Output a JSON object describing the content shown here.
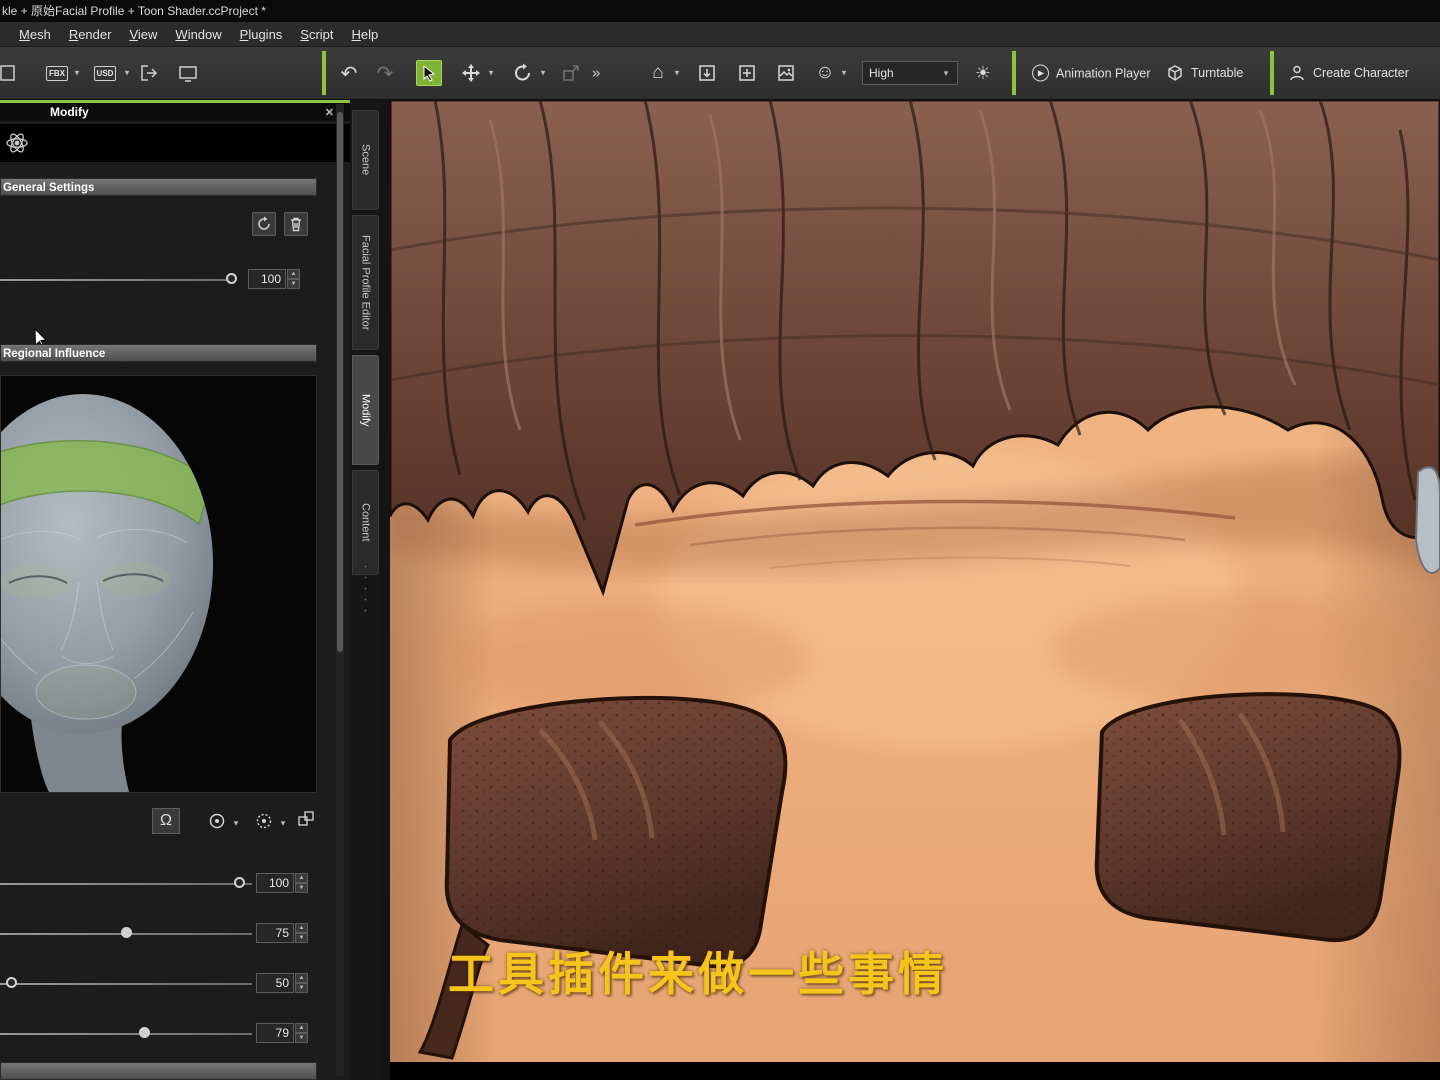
{
  "title_bar": {
    "title": "kle + 原始Facial Profile + Toon Shader.ccProject *"
  },
  "menu": {
    "items": [
      "Mesh",
      "Render",
      "View",
      "Window",
      "Plugins",
      "Script",
      "Help"
    ]
  },
  "toolbar": {
    "fbx_label": "FBX",
    "usd_label": "USD",
    "quality": {
      "value": "High"
    },
    "animation_player_label": "Animation Player",
    "turntable_label": "Turntable",
    "create_character_label": "Create Character"
  },
  "icons": {
    "close": "✕",
    "undo": "↶",
    "redo": "↷",
    "caret": "▾",
    "more": "»",
    "home": "⌂",
    "smiley": "☺",
    "sun": "☀",
    "play": "▶",
    "head": "Ω",
    "spin_up": "▲",
    "spin_down": "▼"
  },
  "side_tabs": {
    "items": [
      "Scene",
      "Facial Profile Editor",
      "Modify",
      "Content"
    ],
    "active": "Modify"
  },
  "panel": {
    "title": "Modify",
    "sections": {
      "general": "General Settings",
      "regional": "Regional Influence"
    },
    "master_slider": {
      "value": "100"
    },
    "region_sliders": [
      {
        "value": "100"
      },
      {
        "value": "75"
      },
      {
        "value": "50"
      },
      {
        "value": "79"
      }
    ]
  },
  "viewport": {
    "subtitle": "工具插件来做一些事情"
  },
  "colors": {
    "accent_green": "#8bc53f",
    "subtitle_yellow": "#f6c51c",
    "skin": "#eaa976",
    "hair": "#6b4436"
  }
}
